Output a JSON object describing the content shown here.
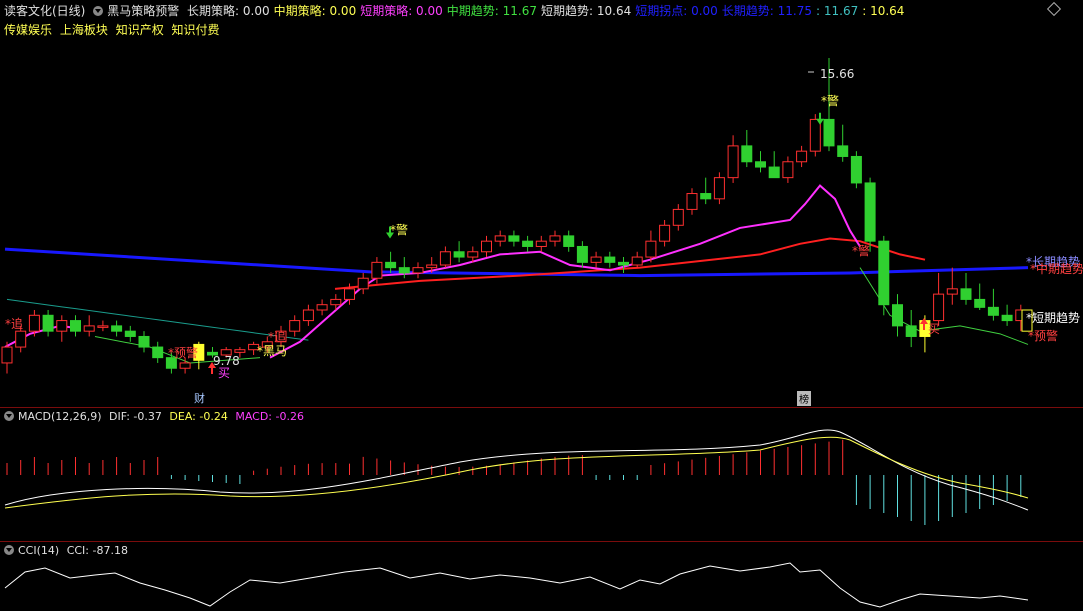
{
  "header": {
    "title": "读客文化(日线)",
    "indicator": "黑马策略预警",
    "items": [
      {
        "text": "长期策略: 0.00",
        "color": "#e0e0e0"
      },
      {
        "text": "中期策略: 0.00",
        "color": "#ffff54"
      },
      {
        "text": "短期策略: 0.00",
        "color": "#ff40ff"
      },
      {
        "text": "中期趋势: 11.67",
        "color": "#40e040"
      },
      {
        "text": "短期趋势: 10.64",
        "color": "#e0e0e0"
      },
      {
        "text": "短期拐点: 0.00",
        "color": "#2020ff"
      },
      {
        "text": "长期趋势: 11.75",
        "color": "#2020ff"
      },
      {
        "text": ": 11.67",
        "color": "#40c0c0"
      },
      {
        "text": ": 10.64",
        "color": "#ffff54"
      }
    ]
  },
  "tags": [
    "传媒娱乐",
    "上海板块",
    "知识产权",
    "知识付费"
  ],
  "price_panel": {
    "high_label": "15.66",
    "low_label": "9.78",
    "caption_left": "财",
    "caption_right": "榜",
    "right_labels": {
      "long_trend": "*长期趋势",
      "mid_trend": "*中期趋势",
      "short_trend": "*短期趋势",
      "warn": "*预警"
    },
    "marks": {
      "warn_top": "*警",
      "warn_mid": "*警",
      "buy": "买",
      "buy2": "买",
      "heima": "*黑马",
      "left_red": "*追",
      "left_warn": "*预警",
      "mid_red": "*追",
      "right_red": "*警"
    }
  },
  "macd": {
    "label": "MACD(12,26,9)",
    "dif": "DIF: -0.37",
    "dea": "DEA: -0.24",
    "macd": "MACD: -0.26"
  },
  "cci": {
    "label": "CCI(14)",
    "value": "CCI: -87.18"
  },
  "colors": {
    "up": "#ff3030",
    "down": "#30d030",
    "doji_yellow": "#ffff30",
    "long_line": "#1818ff",
    "mid_line": "#ff2020",
    "short_line": "#ff30ff",
    "slow_line": "#1a9c8c"
  },
  "candles": [
    [
      9.9,
      10.3,
      9.7,
      10.2
    ],
    [
      10.2,
      10.6,
      10.1,
      10.5
    ],
    [
      10.5,
      10.9,
      10.4,
      10.8
    ],
    [
      10.8,
      10.9,
      10.4,
      10.5
    ],
    [
      10.5,
      10.8,
      10.3,
      10.7
    ],
    [
      10.7,
      10.8,
      10.4,
      10.5
    ],
    [
      10.5,
      10.8,
      10.4,
      10.6
    ],
    [
      10.6,
      10.7,
      10.5,
      10.6
    ],
    [
      10.6,
      10.7,
      10.4,
      10.5
    ],
    [
      10.5,
      10.6,
      10.3,
      10.4
    ],
    [
      10.4,
      10.5,
      10.1,
      10.2
    ],
    [
      10.2,
      10.3,
      9.9,
      10.0
    ],
    [
      10.0,
      10.1,
      9.7,
      9.8
    ],
    [
      9.8,
      10.0,
      9.7,
      9.9
    ],
    [
      9.95,
      10.3,
      9.78,
      10.25
    ],
    [
      10.1,
      10.2,
      10.0,
      10.05
    ],
    [
      10.05,
      10.2,
      10.0,
      10.15
    ],
    [
      10.1,
      10.2,
      10.0,
      10.15
    ],
    [
      10.15,
      10.3,
      10.05,
      10.25
    ],
    [
      10.2,
      10.4,
      10.1,
      10.3
    ],
    [
      10.3,
      10.6,
      10.2,
      10.5
    ],
    [
      10.5,
      10.8,
      10.4,
      10.7
    ],
    [
      10.7,
      11.0,
      10.6,
      10.9
    ],
    [
      10.9,
      11.1,
      10.8,
      11.0
    ],
    [
      11.0,
      11.2,
      10.9,
      11.1
    ],
    [
      11.1,
      11.4,
      11.0,
      11.3
    ],
    [
      11.3,
      11.6,
      11.2,
      11.5
    ],
    [
      11.5,
      11.9,
      11.4,
      11.8
    ],
    [
      11.8,
      12.0,
      11.6,
      11.7
    ],
    [
      11.7,
      11.9,
      11.5,
      11.6
    ],
    [
      11.6,
      11.8,
      11.5,
      11.7
    ],
    [
      11.7,
      11.9,
      11.6,
      11.75
    ],
    [
      11.75,
      12.1,
      11.7,
      12.0
    ],
    [
      12.0,
      12.2,
      11.8,
      11.9
    ],
    [
      11.9,
      12.1,
      11.8,
      12.0
    ],
    [
      12.0,
      12.3,
      11.9,
      12.2
    ],
    [
      12.2,
      12.4,
      12.1,
      12.3
    ],
    [
      12.3,
      12.4,
      12.1,
      12.2
    ],
    [
      12.2,
      12.3,
      12.0,
      12.1
    ],
    [
      12.1,
      12.3,
      12.0,
      12.2
    ],
    [
      12.2,
      12.4,
      12.1,
      12.3
    ],
    [
      12.3,
      12.4,
      12.0,
      12.1
    ],
    [
      12.1,
      12.2,
      11.7,
      11.8
    ],
    [
      11.8,
      12.0,
      11.7,
      11.9
    ],
    [
      11.9,
      12.0,
      11.7,
      11.8
    ],
    [
      11.8,
      11.9,
      11.6,
      11.75
    ],
    [
      11.75,
      12.0,
      11.7,
      11.9
    ],
    [
      11.9,
      12.4,
      11.8,
      12.2
    ],
    [
      12.2,
      12.6,
      12.1,
      12.5
    ],
    [
      12.5,
      12.9,
      12.4,
      12.8
    ],
    [
      12.8,
      13.2,
      12.7,
      13.1
    ],
    [
      13.1,
      13.4,
      12.9,
      13.0
    ],
    [
      13.0,
      13.5,
      12.9,
      13.4
    ],
    [
      13.4,
      14.2,
      13.3,
      14.0
    ],
    [
      14.0,
      14.3,
      13.6,
      13.7
    ],
    [
      13.7,
      13.9,
      13.5,
      13.6
    ],
    [
      13.6,
      13.9,
      13.4,
      13.4
    ],
    [
      13.4,
      13.8,
      13.3,
      13.7
    ],
    [
      13.7,
      14.0,
      13.6,
      13.9
    ],
    [
      13.9,
      14.6,
      13.8,
      14.5
    ],
    [
      14.5,
      15.66,
      13.9,
      14.0
    ],
    [
      14.0,
      14.4,
      13.7,
      13.8
    ],
    [
      13.8,
      13.9,
      13.2,
      13.3
    ],
    [
      13.3,
      13.4,
      12.0,
      12.2
    ],
    [
      12.2,
      12.3,
      10.8,
      11.0
    ],
    [
      11.0,
      11.2,
      10.4,
      10.6
    ],
    [
      10.6,
      10.9,
      10.2,
      10.4
    ],
    [
      10.4,
      10.8,
      10.1,
      10.7
    ],
    [
      10.7,
      11.6,
      10.6,
      11.2
    ],
    [
      11.2,
      11.7,
      11.0,
      11.3
    ],
    [
      11.3,
      11.6,
      11.0,
      11.1
    ],
    [
      11.1,
      11.4,
      10.9,
      10.95
    ],
    [
      10.95,
      11.3,
      10.7,
      10.8
    ],
    [
      10.8,
      11.0,
      10.6,
      10.7
    ],
    [
      10.7,
      11.0,
      10.5,
      10.9
    ]
  ]
}
